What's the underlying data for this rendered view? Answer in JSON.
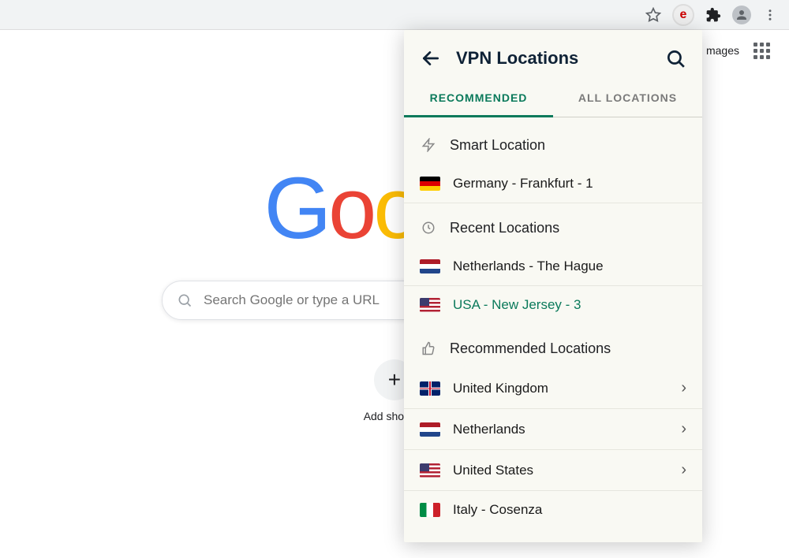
{
  "browser": {
    "images_link": "mages"
  },
  "ntp": {
    "search_placeholder": "Search Google or type a URL",
    "shortcut_label": "Add shortcut"
  },
  "vpn": {
    "title": "VPN Locations",
    "tabs": {
      "recommended": "RECOMMENDED",
      "all": "ALL LOCATIONS"
    },
    "smart_header": "Smart Location",
    "smart_location": "Germany - Frankfurt - 1",
    "recent_header": "Recent Locations",
    "recent": [
      {
        "flag": "nl",
        "label": "Netherlands - The Hague",
        "current": false
      },
      {
        "flag": "us",
        "label": "USA - New Jersey - 3",
        "current": true
      }
    ],
    "recommended_header": "Recommended Locations",
    "recommended": [
      {
        "flag": "gb",
        "label": "United Kingdom",
        "expandable": true
      },
      {
        "flag": "nl",
        "label": "Netherlands",
        "expandable": true
      },
      {
        "flag": "us",
        "label": "United States",
        "expandable": true
      },
      {
        "flag": "it",
        "label": "Italy - Cosenza",
        "expandable": false
      }
    ]
  }
}
